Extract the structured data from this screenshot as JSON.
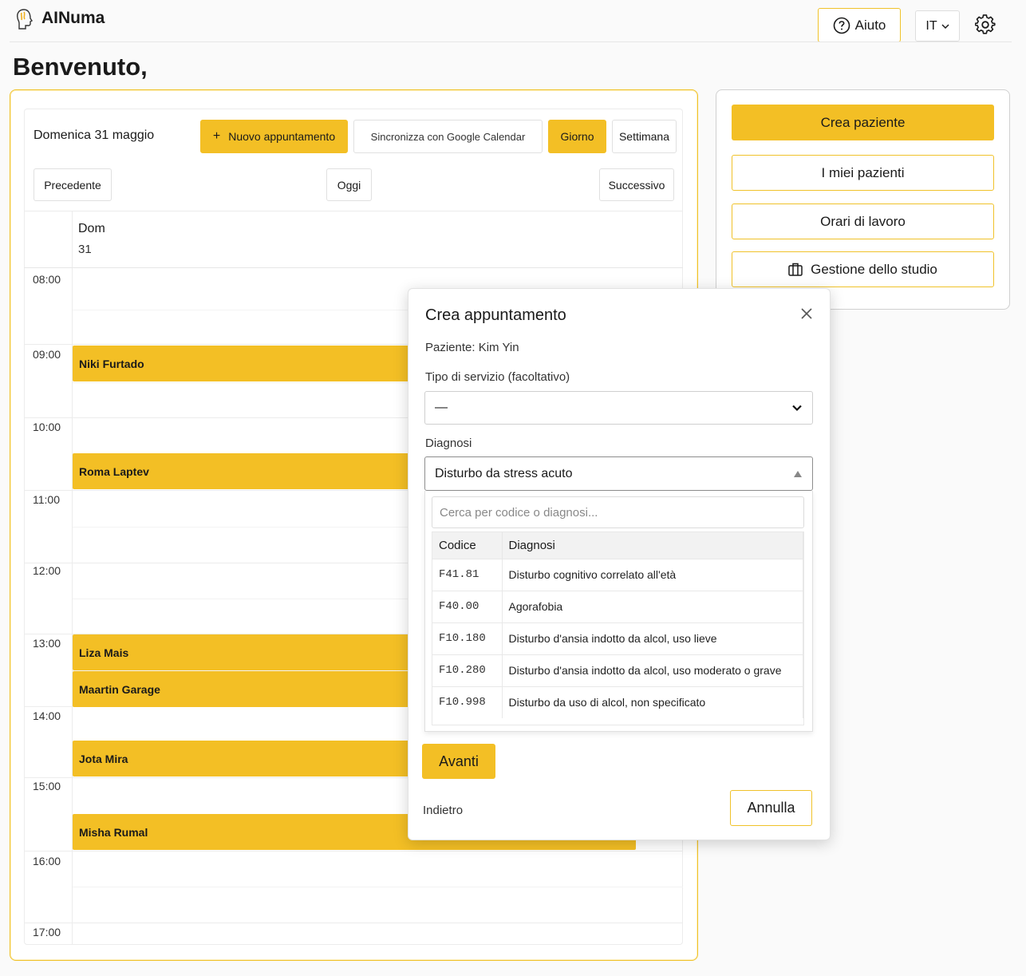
{
  "header": {
    "app_title": "AINuma",
    "help_label": "Aiuto",
    "lang_label": "IT"
  },
  "welcome": "Benvenuto,",
  "calendar": {
    "date_title": "Domenica 31 maggio",
    "new_appointment_label": "Nuovo appuntamento",
    "google_sync_label": "Sincronizza con Google Calendar",
    "day_view_label": "Giorno",
    "week_view_label": "Settimana",
    "prev_label": "Precedente",
    "today_label": "Oggi",
    "next_label": "Successivo",
    "day_name": "Dom",
    "day_number": "31",
    "hours": [
      "08:00",
      "09:00",
      "10:00",
      "11:00",
      "12:00",
      "13:00",
      "14:00",
      "15:00",
      "16:00",
      "17:00"
    ],
    "events": [
      "Niki Furtado",
      "Roma Laptev",
      "Liza Mais",
      "Maartin Garage",
      "Jota Mira",
      "Misha Rumal"
    ]
  },
  "side": {
    "create_patient": "Crea paziente",
    "my_patients": "I miei pazienti",
    "work_hours": "Orari di lavoro",
    "studio_management": "Gestione dello studio"
  },
  "modal": {
    "title": "Crea appuntamento",
    "patient_line": "Paziente: Kim Yin",
    "service_label": "Tipo di servizio (facoltativo)",
    "service_value": "—",
    "diagnosis_label": "Diagnosi",
    "diagnosis_value": "Disturbo da stress acuto",
    "search_placeholder": "Cerca per codice o diagnosi...",
    "table_headers": {
      "code": "Codice",
      "diagnosis": "Diagnosi"
    },
    "rows": [
      {
        "code": "F41.81",
        "diagnosis": "Disturbo cognitivo correlato all'età"
      },
      {
        "code": "F40.00",
        "diagnosis": "Agorafobia"
      },
      {
        "code": "F10.180",
        "diagnosis": "Disturbo d'ansia indotto da alcol, uso lieve"
      },
      {
        "code": "F10.280",
        "diagnosis": "Disturbo d'ansia indotto da alcol, uso moderato o grave"
      },
      {
        "code": "F10.998",
        "diagnosis": "Disturbo da uso di alcol, non specificato"
      }
    ],
    "next_label": "Avanti",
    "back_label": "Indietro",
    "cancel_label": "Annulla"
  },
  "colors": {
    "accent": "#f3bf25",
    "accent_border": "#f0c22a"
  }
}
